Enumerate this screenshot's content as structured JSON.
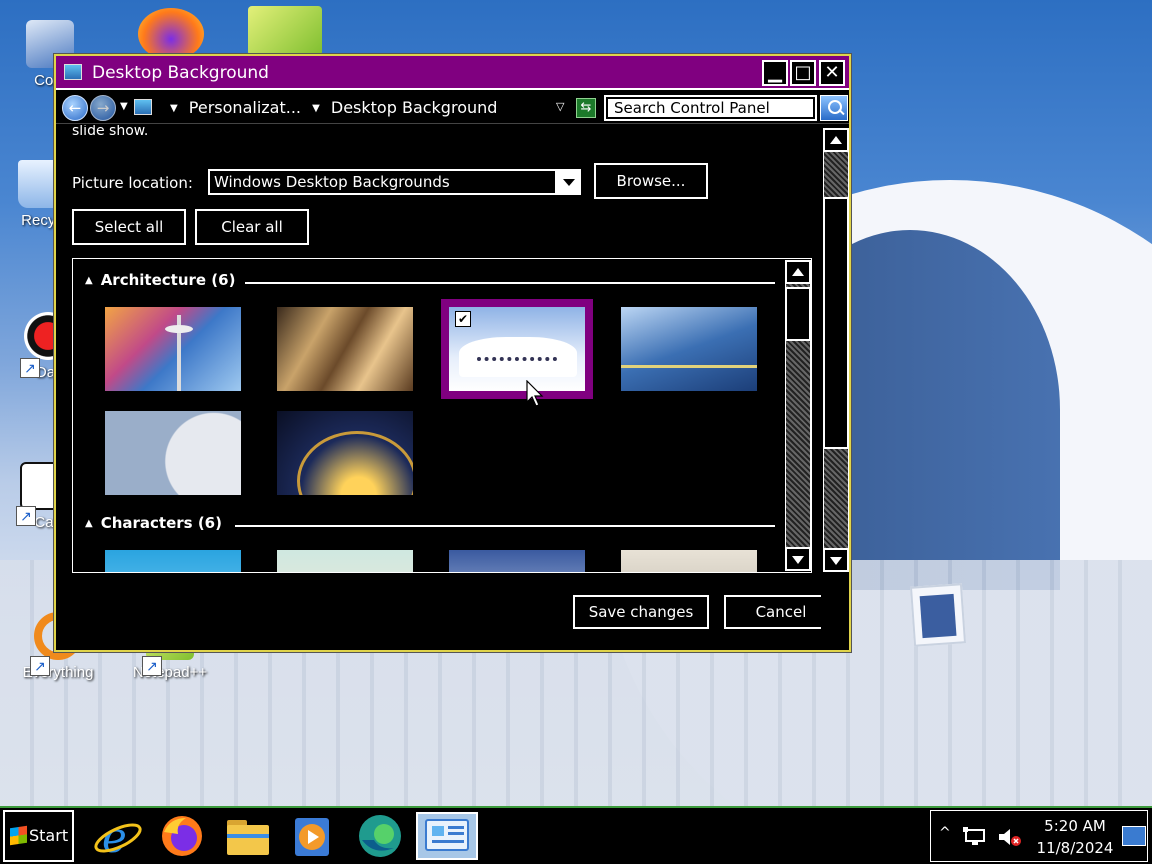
{
  "desktop": {
    "icons": [
      {
        "label": "Com",
        "icon": "computer-icon"
      },
      {
        "label": "Recyc",
        "icon": "recycle-bin-icon"
      },
      {
        "label": "Dar",
        "icon": "app-icon"
      },
      {
        "label": "Ca",
        "icon": "app-icon"
      },
      {
        "label": "Everything",
        "icon": "search-app-icon"
      },
      {
        "label": "Notepad++",
        "icon": "notepad-icon"
      }
    ]
  },
  "window": {
    "title": "Desktop Background",
    "controls": {
      "minimize": "▁",
      "maximize": "□",
      "close": "✕"
    }
  },
  "addressbar": {
    "back": "←",
    "forward": "→",
    "crumbs": [
      "Personalizat...",
      "Desktop Background"
    ],
    "search_placeholder": "Search Control Panel"
  },
  "content": {
    "cut_text": "slide show.",
    "picture_location_label": "Picture location:",
    "picture_location_value": "Windows Desktop Backgrounds",
    "browse_label": "Browse...",
    "select_all_label": "Select all",
    "clear_all_label": "Clear all",
    "groups": [
      {
        "title": "Architecture (6)"
      },
      {
        "title": "Characters (6)"
      }
    ],
    "selected_check": "✔",
    "save_label": "Save changes",
    "cancel_label": "Cancel"
  },
  "taskbar": {
    "start_label": "Start",
    "apps": [
      "internet-explorer-icon",
      "firefox-icon",
      "file-explorer-icon",
      "media-player-icon",
      "edge-icon",
      "control-panel-icon"
    ],
    "tray": {
      "expand": "^"
    },
    "clock": {
      "time": "5:20 AM",
      "date": "11/8/2024"
    }
  },
  "colors": {
    "accent": "#800080",
    "window_bg": "#000000",
    "border": "#e0d44a",
    "taskbar_border": "#3c9b3c"
  }
}
